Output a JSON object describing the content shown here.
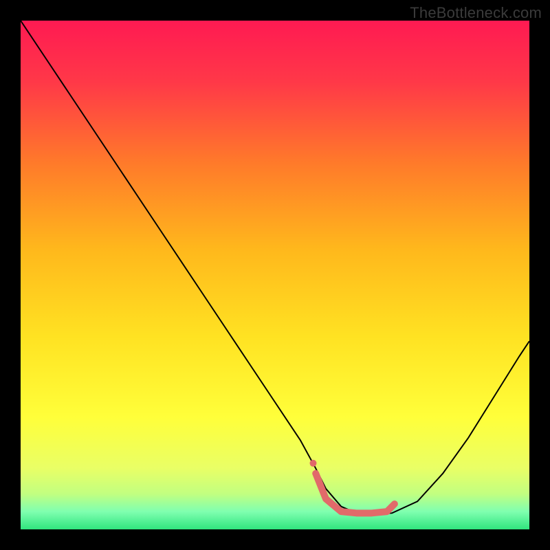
{
  "watermark": "TheBottleneck.com",
  "chart_data": {
    "type": "line",
    "title": "",
    "xlabel": "",
    "ylabel": "",
    "xlim": [
      0,
      100
    ],
    "ylim": [
      0,
      100
    ],
    "legend": false,
    "grid": false,
    "background_gradient": {
      "stops": [
        {
          "pos": 0.0,
          "color": "#ff1a52"
        },
        {
          "pos": 0.12,
          "color": "#ff3848"
        },
        {
          "pos": 0.28,
          "color": "#ff7a2a"
        },
        {
          "pos": 0.45,
          "color": "#ffb81c"
        },
        {
          "pos": 0.62,
          "color": "#ffe222"
        },
        {
          "pos": 0.78,
          "color": "#ffff3a"
        },
        {
          "pos": 0.88,
          "color": "#e9ff66"
        },
        {
          "pos": 0.93,
          "color": "#c2ff80"
        },
        {
          "pos": 0.965,
          "color": "#7fffb0"
        },
        {
          "pos": 1.0,
          "color": "#30e57d"
        }
      ]
    },
    "series": [
      {
        "name": "bottleneck-curve",
        "stroke": "#000000",
        "stroke_width": 2,
        "x": [
          0,
          5,
          10,
          15,
          20,
          25,
          30,
          35,
          40,
          45,
          50,
          55,
          58,
          60,
          63,
          66,
          69,
          73,
          78,
          83,
          88,
          93,
          98,
          100
        ],
        "y": [
          100,
          92.5,
          85,
          77.5,
          70,
          62.5,
          55,
          47.5,
          40,
          32.5,
          25,
          17.5,
          12,
          8,
          4.5,
          3.2,
          3,
          3.2,
          5.5,
          11,
          18,
          26,
          34,
          37
        ]
      },
      {
        "name": "highlight-segment",
        "stroke": "#e16a6a",
        "stroke_width": 10,
        "linecap": "round",
        "x": [
          58,
          60,
          63,
          66,
          69,
          72,
          73.5
        ],
        "y": [
          11,
          6,
          3.5,
          3.2,
          3.2,
          3.5,
          5
        ]
      },
      {
        "name": "highlight-dot",
        "type": "scatter",
        "color": "#e16a6a",
        "radius": 5,
        "x": [
          57.5
        ],
        "y": [
          13
        ]
      }
    ]
  }
}
